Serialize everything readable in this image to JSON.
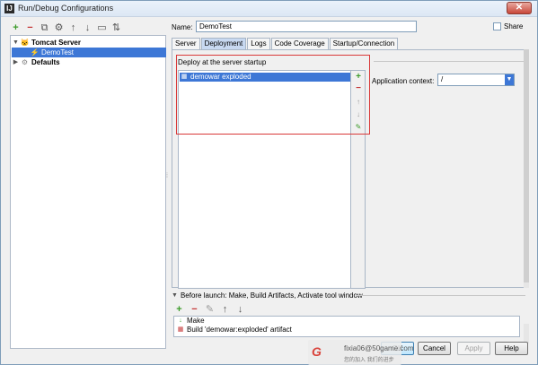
{
  "window": {
    "title": "Run/Debug Configurations",
    "app_icon": "IJ",
    "close_glyph": "✕"
  },
  "left_toolbar": [
    {
      "name": "add-config-icon",
      "glyph": "+",
      "cls": "green"
    },
    {
      "name": "remove-config-icon",
      "glyph": "−",
      "cls": "red"
    },
    {
      "name": "copy-config-icon",
      "glyph": "⧉",
      "cls": ""
    },
    {
      "name": "edit-defaults-icon",
      "glyph": "⚙",
      "cls": ""
    },
    {
      "name": "move-up-icon",
      "glyph": "↑",
      "cls": ""
    },
    {
      "name": "move-down-icon",
      "glyph": "↓",
      "cls": ""
    },
    {
      "name": "folder-icon",
      "glyph": "▭",
      "cls": ""
    },
    {
      "name": "sort-icon",
      "glyph": "⇅",
      "cls": ""
    }
  ],
  "tree": {
    "tomcat_server": "Tomcat Server",
    "demotest": "DemoTest",
    "defaults": "Defaults",
    "expanded_glyph": "▼",
    "collapsed_glyph": "▶",
    "server_icon": "🐱",
    "config_icon": "⚡"
  },
  "config": {
    "name_label": "Name:",
    "name_value": "DemoTest",
    "share_label": "Share"
  },
  "tabs": [
    "Server",
    "Deployment",
    "Logs",
    "Code Coverage",
    "Startup/Connection"
  ],
  "active_tab": "Deployment",
  "deployment": {
    "section_label": "Deploy at the server startup",
    "items": [
      "demowar exploded"
    ],
    "item_icon": "▦",
    "side_buttons": {
      "add": "+",
      "remove": "−",
      "up": "↑",
      "down": "↓",
      "edit": "✎"
    },
    "app_context_label": "Application context:",
    "app_context_value": "/",
    "dropdown_glyph": "▼"
  },
  "before_launch": {
    "header": "Before launch: Make, Build Artifacts, Activate tool window",
    "toggle_glyph": "▼",
    "toolbar": {
      "add": "+",
      "remove": "−",
      "edit": "✎",
      "up": "↑",
      "down": "↓"
    },
    "items": [
      {
        "label": "Make",
        "icon": "↓"
      },
      {
        "label": "Build 'demowar:exploded' artifact",
        "icon": "▦"
      }
    ]
  },
  "buttons": {
    "ok": "OK",
    "cancel": "Cancel",
    "apply": "Apply",
    "help": "Help"
  },
  "watermark": {
    "logo": "G",
    "line1": "fixia06@50game.com",
    "line2": "您的加入 我们的进步"
  }
}
